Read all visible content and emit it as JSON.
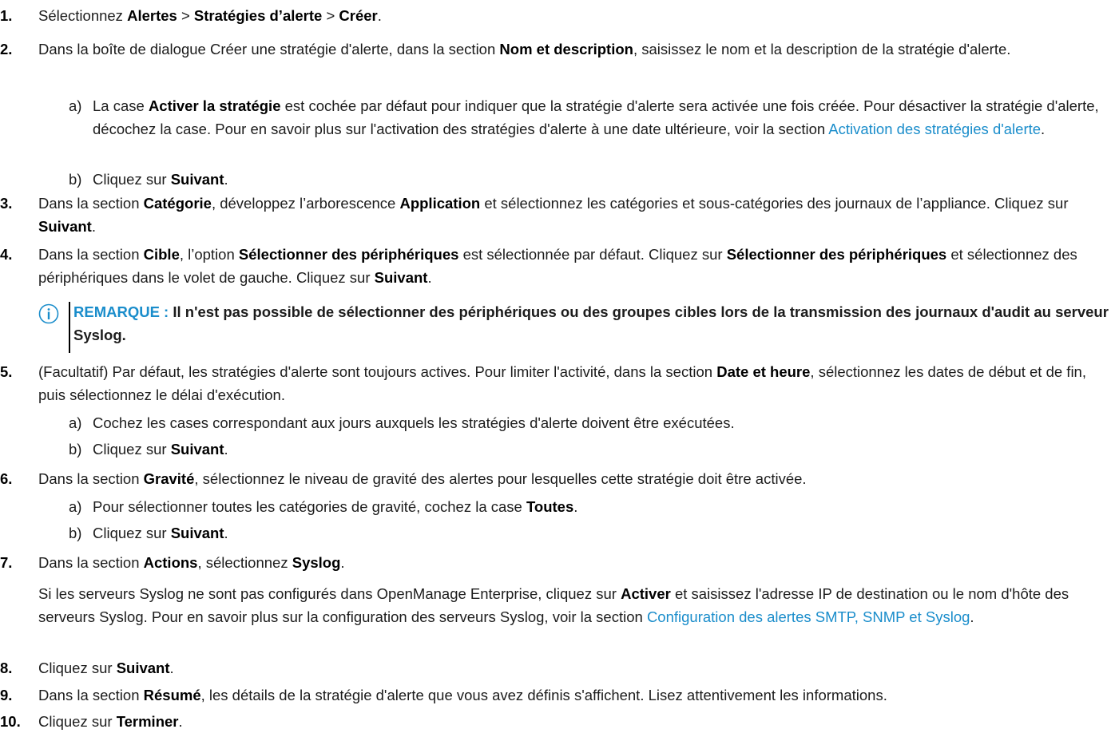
{
  "steps": {
    "s1": {
      "num": "1.",
      "t1": "Sélectionnez ",
      "b1": "Alertes",
      "t2": " > ",
      "b2": "Stratégies d’alerte",
      "t3": " > ",
      "b3": "Créer",
      "t4": "."
    },
    "s2": {
      "num": "2.",
      "t1": "Dans la boîte de dialogue Créer une stratégie d'alerte, dans la section ",
      "b1": "Nom et description",
      "t2": ", saisissez le nom et la description de la stratégie d'alerte."
    },
    "s2a": {
      "letter": "a)",
      "t1": "La case ",
      "b1": "Activer la stratégie",
      "t2": " est cochée par défaut pour indiquer que la stratégie d'alerte sera activée une fois créée. Pour désactiver la stratégie d'alerte, décochez la case. Pour en savoir plus sur l'activation des stratégies d'alerte à une date ultérieure, voir la section ",
      "link": "Activation des stratégies d'alerte",
      "t3": "."
    },
    "s2b": {
      "letter": "b)",
      "t1": "Cliquez sur ",
      "b1": "Suivant",
      "t2": "."
    },
    "s3": {
      "num": "3.",
      "t1": "Dans la section ",
      "b1": "Catégorie",
      "t2": ", développez l’arborescence ",
      "b2": "Application",
      "t3": " et sélectionnez les catégories et sous-catégories des journaux de l’appliance. Cliquez sur ",
      "b3": "Suivant",
      "t4": "."
    },
    "s4": {
      "num": "4.",
      "t1": "Dans la section ",
      "b1": "Cible",
      "t2": ", l’option ",
      "b2": "Sélectionner des périphériques",
      "t3": " est sélectionnée par défaut. Cliquez sur ",
      "b3": "Sélectionner des périphériques",
      "t4": " et sélectionnez des périphériques dans le volet de gauche. Cliquez sur ",
      "b4": "Suivant",
      "t5": "."
    },
    "note": {
      "label": "REMARQUE :",
      "text": " Il n'est pas possible de sélectionner des périphériques ou des groupes cibles lors de la transmission des journaux d'audit au serveur Syslog."
    },
    "s5": {
      "num": "5.",
      "t1": "(Facultatif) Par défaut, les stratégies d'alerte sont toujours actives. Pour limiter l'activité, dans la section ",
      "b1": "Date et heure",
      "t2": ", sélectionnez les dates de début et de fin, puis sélectionnez le délai d'exécution."
    },
    "s5a": {
      "letter": "a)",
      "t1": "Cochez les cases correspondant aux jours auxquels les stratégies d'alerte doivent être exécutées."
    },
    "s5b": {
      "letter": "b)",
      "t1": "Cliquez sur ",
      "b1": "Suivant",
      "t2": "."
    },
    "s6": {
      "num": "6.",
      "t1": "Dans la section ",
      "b1": "Gravité",
      "t2": ", sélectionnez le niveau de gravité des alertes pour lesquelles cette stratégie doit être activée."
    },
    "s6a": {
      "letter": "a)",
      "t1": "Pour sélectionner toutes les catégories de gravité, cochez la case ",
      "b1": "Toutes",
      "t2": "."
    },
    "s6b": {
      "letter": "b)",
      "t1": "Cliquez sur ",
      "b1": "Suivant",
      "t2": "."
    },
    "s7": {
      "num": "7.",
      "t1": "Dans la section ",
      "b1": "Actions",
      "t2": ", sélectionnez ",
      "b2": "Syslog",
      "t3": "."
    },
    "s7p": {
      "t1": "Si les serveurs Syslog ne sont pas configurés dans OpenManage Enterprise, cliquez sur ",
      "b1": "Activer",
      "t2": " et saisissez l'adresse IP de destination ou le nom d'hôte des serveurs Syslog. Pour en savoir plus sur la configuration des serveurs Syslog, voir la section ",
      "link": "Configuration des alertes SMTP, SNMP et Syslog",
      "t3": "."
    },
    "s8": {
      "num": "8.",
      "t1": "Cliquez sur ",
      "b1": "Suivant",
      "t2": "."
    },
    "s9": {
      "num": "9.",
      "t1": "Dans la section ",
      "b1": "Résumé",
      "t2": ", les détails de la stratégie d'alerte que vous avez définis s'affichent. Lisez attentivement les informations."
    },
    "s10": {
      "num": "10.",
      "t1": "Cliquez sur ",
      "b1": "Terminer",
      "t2": "."
    }
  },
  "colors": {
    "link": "#1a8dcb",
    "text": "#1c1c1c"
  },
  "icons": {
    "note": "info-circle-icon"
  }
}
